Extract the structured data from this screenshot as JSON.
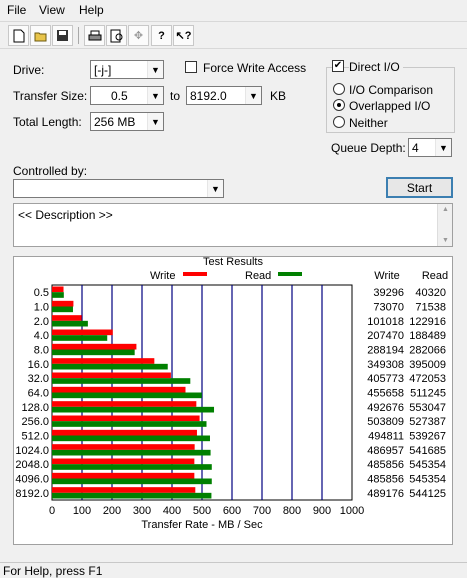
{
  "menu": [
    "File",
    "View",
    "Help"
  ],
  "toolbar_icons": [
    "new-icon",
    "open-icon",
    "save-icon",
    "print-icon",
    "print-preview-icon",
    "move-icon",
    "help-icon",
    "context-help-icon"
  ],
  "drive": {
    "label": "Drive:",
    "value": "[-j-]"
  },
  "force_write": {
    "label": "Force Write Access",
    "checked": false
  },
  "transfer_size": {
    "label": "Transfer Size:",
    "from": "0.5",
    "to_label": "to",
    "to": "8192.0",
    "unit": "KB"
  },
  "total_length": {
    "label": "Total Length:",
    "value": "256 MB"
  },
  "direct_io": {
    "label": "Direct I/O",
    "checked": true
  },
  "io_modes": [
    {
      "label": "I/O Comparison",
      "selected": false
    },
    {
      "label": "Overlapped I/O",
      "selected": true
    },
    {
      "label": "Neither",
      "selected": false
    }
  ],
  "queue_depth": {
    "label": "Queue Depth:",
    "value": "4"
  },
  "controlled_by": {
    "label": "Controlled by:",
    "value": ""
  },
  "start_button": "Start",
  "description": "<< Description >>",
  "status_text": "For Help, press F1",
  "chart_data": {
    "type": "bar",
    "orientation": "horizontal",
    "title": "Test Results",
    "xlabel": "Transfer Rate - MB / Sec",
    "xlim": [
      0,
      1000
    ],
    "xticks": [
      0,
      100,
      200,
      300,
      400,
      500,
      600,
      700,
      800,
      900,
      1000
    ],
    "legend": [
      {
        "name": "Write",
        "color": "#ff0000"
      },
      {
        "name": "Read",
        "color": "#008000"
      }
    ],
    "categories": [
      "0.5",
      "1.0",
      "2.0",
      "4.0",
      "8.0",
      "16.0",
      "32.0",
      "64.0",
      "128.0",
      "256.0",
      "512.0",
      "1024.0",
      "2048.0",
      "4096.0",
      "8192.0"
    ],
    "series": [
      {
        "name": "Write",
        "color": "#ff0000",
        "values": [
          38.4,
          71.4,
          98.6,
          202.6,
          281.4,
          341.1,
          396.3,
          445.0,
          481.1,
          492.0,
          483.2,
          475.5,
          474.5,
          474.5,
          477.7
        ]
      },
      {
        "name": "Read",
        "color": "#008000",
        "values": [
          39.4,
          69.9,
          119.6,
          184.1,
          275.6,
          385.8,
          461.0,
          499.3,
          540.1,
          515.0,
          526.6,
          528.6,
          532.6,
          532.6,
          531.4
        ]
      }
    ],
    "table_headers": [
      "Write",
      "Read"
    ],
    "write_values": [
      "39296",
      "73070",
      "101018",
      "207470",
      "288194",
      "349308",
      "405773",
      "455658",
      "492676",
      "503809",
      "494811",
      "486957",
      "485856",
      "485856",
      "489176"
    ],
    "read_values": [
      "40320",
      "71538",
      "122916",
      "188489",
      "282066",
      "395009",
      "472053",
      "511245",
      "553047",
      "527387",
      "539267",
      "541685",
      "545354",
      "545354",
      "544125"
    ]
  }
}
